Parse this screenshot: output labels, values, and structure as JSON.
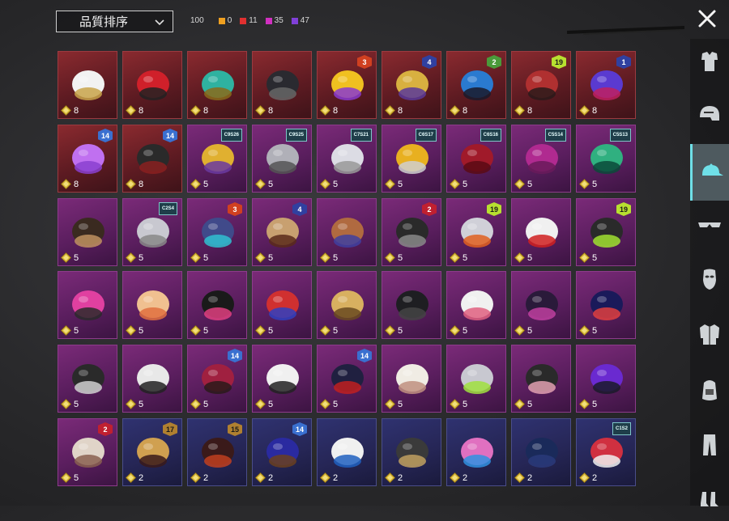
{
  "sort": {
    "label": "品質排序"
  },
  "counts": {
    "total": "100",
    "items": [
      {
        "value": "0",
        "color": "#f0a020"
      },
      {
        "value": "11",
        "color": "#e03030"
      },
      {
        "value": "35",
        "color": "#d030c0"
      },
      {
        "value": "47",
        "color": "#8040d8"
      }
    ]
  },
  "close_icon": "close-icon",
  "sidebar": {
    "tabs": [
      {
        "icon": "outfit-icon",
        "active": false
      },
      {
        "icon": "helmet-icon",
        "active": false
      },
      {
        "icon": "cap-icon",
        "active": true
      },
      {
        "icon": "glasses-icon",
        "active": false
      },
      {
        "icon": "mask-icon",
        "active": false
      },
      {
        "icon": "jacket-icon",
        "active": false
      },
      {
        "icon": "backpack-icon",
        "active": false
      },
      {
        "icon": "pants-icon",
        "active": false
      },
      {
        "icon": "shoes-icon",
        "active": false
      }
    ]
  },
  "inventory": [
    {
      "qty": "8",
      "rarity": "red",
      "badge": "",
      "art": "cowboy-hat"
    },
    {
      "qty": "8",
      "rarity": "red",
      "badge": "",
      "art": "red-helmet"
    },
    {
      "qty": "8",
      "rarity": "red",
      "badge": "",
      "art": "teal-crest-helmet"
    },
    {
      "qty": "8",
      "rarity": "red",
      "badge": "",
      "art": "dark-horn-helmet"
    },
    {
      "qty": "8",
      "rarity": "red",
      "badge": "3",
      "art": "fries-hat"
    },
    {
      "qty": "8",
      "rarity": "red",
      "badge": "4",
      "art": "gold-dragon-helmet"
    },
    {
      "qty": "8",
      "rarity": "red",
      "badge": "2",
      "art": "blue-spike-helmet"
    },
    {
      "qty": "8",
      "rarity": "red",
      "badge": "19",
      "art": "samurai-helmet"
    },
    {
      "qty": "8",
      "rarity": "red",
      "badge": "1",
      "art": "purple-mask-helmet"
    },
    {
      "qty": "8",
      "rarity": "red",
      "badge": "14",
      "art": "purple-crystal-hat"
    },
    {
      "qty": "8",
      "rarity": "red",
      "badge": "14",
      "art": "officer-cap"
    },
    {
      "qty": "5",
      "rarity": "purple",
      "badge": "C9S26",
      "art": "yellow-creature-hat"
    },
    {
      "qty": "5",
      "rarity": "purple",
      "badge": "C9S25",
      "art": "grey-hair"
    },
    {
      "qty": "5",
      "rarity": "purple",
      "badge": "C7S21",
      "art": "silver-hair"
    },
    {
      "qty": "5",
      "rarity": "purple",
      "badge": "C6S17",
      "art": "visor-wig"
    },
    {
      "qty": "5",
      "rarity": "purple",
      "badge": "C6S16",
      "art": "red-hair"
    },
    {
      "qty": "5",
      "rarity": "purple",
      "badge": "C5S14",
      "art": "magenta-hair"
    },
    {
      "qty": "5",
      "rarity": "purple",
      "badge": "C5S13",
      "art": "green-cat-hat"
    },
    {
      "qty": "5",
      "rarity": "purple",
      "badge": "",
      "art": "goggle-dreadlocks"
    },
    {
      "qty": "5",
      "rarity": "purple",
      "badge": "C2S4",
      "art": "grey-wig"
    },
    {
      "qty": "5",
      "rarity": "purple",
      "badge": "3",
      "art": "ufo-hat"
    },
    {
      "qty": "5",
      "rarity": "purple",
      "badge": "4",
      "art": "skull-mask"
    },
    {
      "qty": "5",
      "rarity": "purple",
      "badge": "",
      "art": "diving-helmet"
    },
    {
      "qty": "5",
      "rarity": "purple",
      "badge": "2",
      "art": "braided-helmet"
    },
    {
      "qty": "5",
      "rarity": "purple",
      "badge": "19",
      "art": "headphone-hair"
    },
    {
      "qty": "5",
      "rarity": "purple",
      "badge": "",
      "art": "panda-head"
    },
    {
      "qty": "5",
      "rarity": "purple",
      "badge": "19",
      "art": "goggle-helmet"
    },
    {
      "qty": "5",
      "rarity": "purple",
      "badge": "",
      "art": "pink-cat-mask"
    },
    {
      "qty": "5",
      "rarity": "purple",
      "badge": "",
      "art": "beanie-hat"
    },
    {
      "qty": "5",
      "rarity": "purple",
      "badge": "",
      "art": "witch-hat"
    },
    {
      "qty": "5",
      "rarity": "purple",
      "badge": "",
      "art": "tribal-headdress"
    },
    {
      "qty": "5",
      "rarity": "purple",
      "badge": "",
      "art": "gold-mask"
    },
    {
      "qty": "5",
      "rarity": "purple",
      "badge": "",
      "art": "black-helmet"
    },
    {
      "qty": "5",
      "rarity": "purple",
      "badge": "",
      "art": "sun-hat"
    },
    {
      "qty": "5",
      "rarity": "purple",
      "badge": "",
      "art": "top-hat-mask"
    },
    {
      "qty": "5",
      "rarity": "purple",
      "badge": "",
      "art": "blue-top-hat"
    },
    {
      "qty": "5",
      "rarity": "purple",
      "badge": "",
      "art": "ribbon-headdress"
    },
    {
      "qty": "5",
      "rarity": "purple",
      "badge": "",
      "art": "zebra-mask"
    },
    {
      "qty": "5",
      "rarity": "purple",
      "badge": "14",
      "art": "red-hat-hair"
    },
    {
      "qty": "5",
      "rarity": "purple",
      "badge": "",
      "art": "bunny-astronaut"
    },
    {
      "qty": "5",
      "rarity": "purple",
      "badge": "14",
      "art": "peaked-cap"
    },
    {
      "qty": "5",
      "rarity": "purple",
      "badge": "",
      "art": "sheep-head"
    },
    {
      "qty": "5",
      "rarity": "purple",
      "badge": "",
      "art": "grey-ponytail"
    },
    {
      "qty": "5",
      "rarity": "purple",
      "badge": "",
      "art": "straw-hat-mask"
    },
    {
      "qty": "5",
      "rarity": "purple",
      "badge": "",
      "art": "purple-bug-helmet"
    },
    {
      "qty": "5",
      "rarity": "purple",
      "badge": "2",
      "art": "rabbit-head"
    },
    {
      "qty": "2",
      "rarity": "blue",
      "badge": "17",
      "art": "gold-cap-hair"
    },
    {
      "qty": "2",
      "rarity": "blue",
      "badge": "15",
      "art": "pumpkin-hair"
    },
    {
      "qty": "2",
      "rarity": "blue",
      "badge": "14",
      "art": "wizard-hair"
    },
    {
      "qty": "2",
      "rarity": "blue",
      "badge": "",
      "art": "baseball-cap"
    },
    {
      "qty": "2",
      "rarity": "blue",
      "badge": "",
      "art": "military-helmet"
    },
    {
      "qty": "2",
      "rarity": "blue",
      "badge": "",
      "art": "pink-helmet"
    },
    {
      "qty": "2",
      "rarity": "blue",
      "badge": "",
      "art": "navy-cap"
    },
    {
      "qty": "2",
      "rarity": "blue",
      "badge": "C1S2",
      "art": "flag-helmet"
    }
  ]
}
